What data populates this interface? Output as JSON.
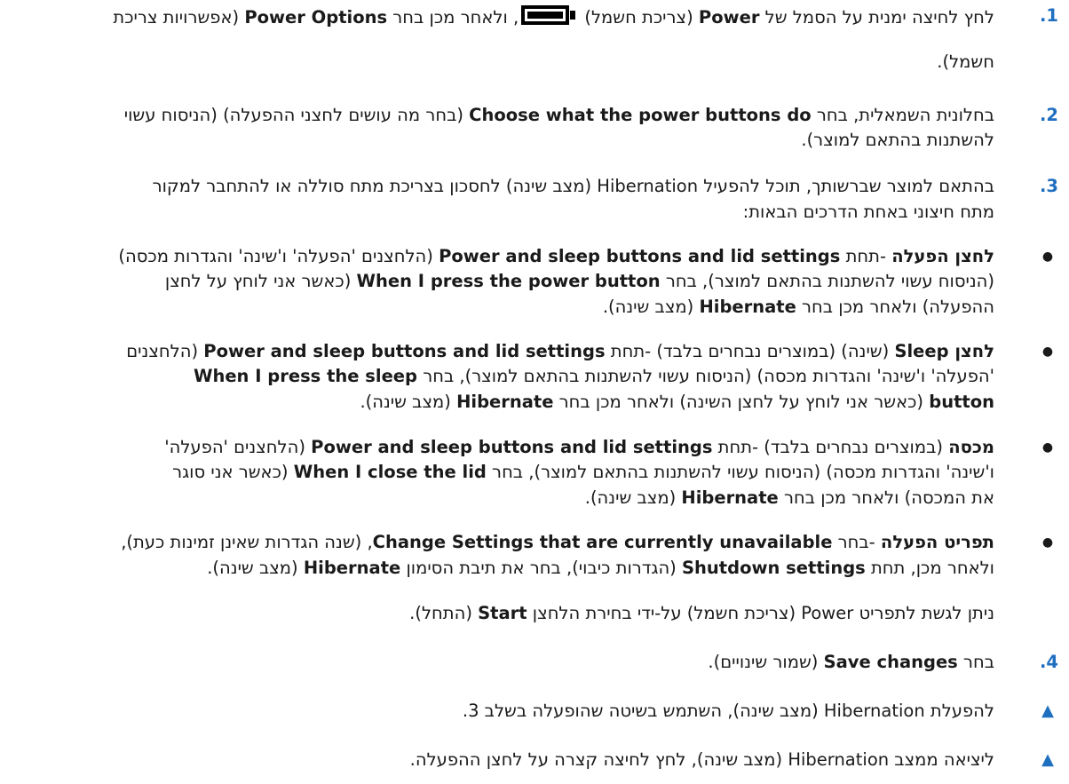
{
  "steps": {
    "s1": {
      "num": "1.",
      "l1_a": "לחץ לחיצה ימנית על הסמל של ",
      "l1_power": "Power",
      "l1_b": " (צריכת חשמל) ",
      "l1_c": ", ולאחר מכן בחר ",
      "l1_options": "Power Options",
      "l1_d": " (אפשרויות צריכת",
      "l2": "חשמל)."
    },
    "s2": {
      "num": "2.",
      "l1_a": "בחלונית השמאלית, בחר ",
      "l1_choose": "Choose what the power buttons do",
      "l1_b": " (בחר מה עושים לחצני ההפעלה) (הניסוח עשוי",
      "l2": "להשתנות בהתאם למוצר)."
    },
    "s3": {
      "num": "3.",
      "l1": "בהתאם למוצר שברשותך, תוכל להפעיל Hibernation (מצב שינה) לחסכון בצריכת מתח סוללה או להתחבר למקור",
      "l2": "מתח חיצוני באחת הדרכים הבאות:"
    },
    "bullets": {
      "b1": {
        "l1_title": "לחצן הפעלה",
        "l1_a": " -תחת ",
        "l1_pslid": "Power and sleep buttons and lid settings",
        "l1_b": " (הלחצנים 'הפעלה' ו'שינה' והגדרות מכסה)",
        "l2_a": "(הניסוח עשוי להשתנות בהתאם למוצר), בחר ",
        "l2_when": "When I press the power button",
        "l2_b": " (כאשר אני לוחץ על לחצן",
        "l3_a": "ההפעלה) ולאחר מכן בחר ",
        "l3_hib": "Hibernate",
        "l3_b": " (מצב שינה)."
      },
      "b2": {
        "l1_title": "לחצן Sleep",
        "l1_a": " (שינה) (במוצרים נבחרים בלבד) -תחת ",
        "l1_pslid": "Power and sleep buttons and lid settings",
        "l1_b": " (הלחצנים",
        "l2_a": "'הפעלה' ו'שינה' והגדרות מכסה) (הניסוח עשוי להשתנות בהתאם למוצר), בחר ",
        "l2_when": "When I press the sleep",
        "l3_button": "button",
        "l3_a": " (כאשר אני לוחץ על לחצן השינה) ולאחר מכן בחר ",
        "l3_hib": "Hibernate",
        "l3_b": " (מצב שינה)."
      },
      "b3": {
        "l1_title": "מכסה",
        "l1_a": " (במוצרים נבחרים בלבד) -תחת ",
        "l1_pslid": "Power and sleep buttons and lid settings",
        "l1_b": " (הלחצנים 'הפעלה'",
        "l2_a": "ו'שינה' והגדרות מכסה) (הניסוח עשוי להשתנות בהתאם למוצר), בחר ",
        "l2_when": "When I close the lid",
        "l2_b": " (כאשר אני סוגר",
        "l3_a": "את המכסה) ולאחר מכן בחר ",
        "l3_hib": "Hibernate",
        "l3_b": " (מצב שינה)."
      },
      "b4": {
        "l1_title": "תפריט הפעלה",
        "l1_a": " -בחר ",
        "l1_change": "Change Settings that are currently unavailable",
        "l1_b": ", (שנה הגדרות שאינן זמינות כעת),",
        "l2_a": "ולאחר מכן, תחת ",
        "l2_shut": "Shutdown settings",
        "l2_b": " (הגדרות כיבוי), בחר את תיבת הסימון ",
        "l2_hib": "Hibernate",
        "l2_c": " (מצב שינה)."
      },
      "note_a": "ניתן לגשת לתפריט Power (צריכת חשמל) על-ידי בחירת הלחצן ",
      "note_start": "Start",
      "note_b": " (התחל)."
    },
    "s4": {
      "num": "4.",
      "a": "בחר ",
      "save": "Save changes",
      "b": " (שמור שינויים)."
    }
  },
  "notes": {
    "n1": "להפעלת Hibernation (מצב שינה), השתמש בשיטה שהופעלה בשלב 3.",
    "n2": "ליציאה ממצב Hibernation (מצב שינה), לחץ לחיצה קצרה על לחצן ההפעלה."
  },
  "icons": {
    "battery": "battery-icon",
    "bullet": "bullet-dot-icon",
    "note": "note-triangle-icon"
  },
  "colors": {
    "step_number": "#1f6fc0",
    "note_triangle": "#1f6fc0",
    "text": "#1a1a1a"
  }
}
